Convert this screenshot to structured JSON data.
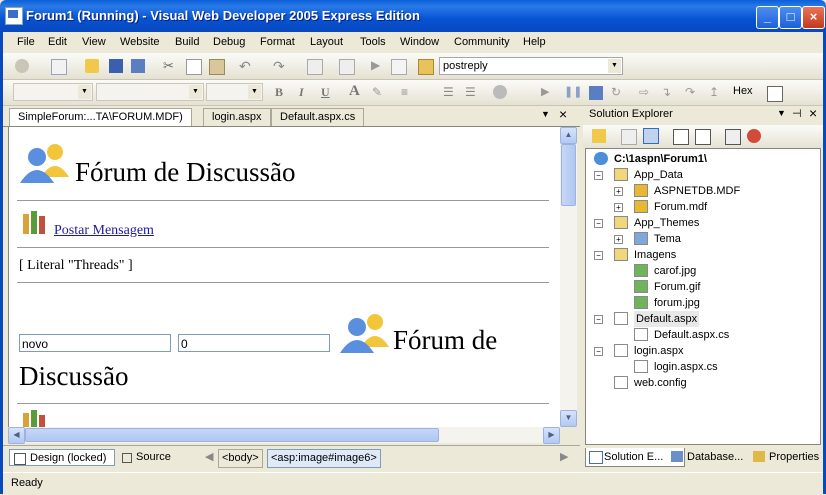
{
  "window": {
    "title": "Forum1 (Running) - Visual Web Developer 2005 Express Edition",
    "min": "_",
    "max": "□",
    "close": "×"
  },
  "menu": [
    "File",
    "Edit",
    "View",
    "Website",
    "Build",
    "Debug",
    "Format",
    "Layout",
    "Tools",
    "Window",
    "Community",
    "Help"
  ],
  "toolbar": {
    "find_combo": "postreply",
    "hex_label": "Hex",
    "bold": "B",
    "italic": "I",
    "underline": "U",
    "font_a": "A"
  },
  "doc_tabs": [
    "SimpleForum:...TA\\FORUM.MDF)",
    "login.aspx",
    "Default.aspx.cs"
  ],
  "design": {
    "heading1": "Fórum de Discussão",
    "post_link": "Postar Mensagem",
    "literal": "[ Literal \"Threads\" ]",
    "input1": "novo",
    "input2": "0",
    "heading2_line1": "Fórum de",
    "heading2_line2": "Discussão"
  },
  "view_bar": {
    "design": "Design (locked)",
    "source": "Source",
    "crumb1": "<body>",
    "crumb2": "<asp:image#image6>"
  },
  "solution_explorer": {
    "title": "Solution Explorer",
    "root": "C:\\1aspn\\Forum1\\",
    "items": [
      {
        "label": "App_Data",
        "level": 1,
        "icon": "folder-icon",
        "toggle": "−"
      },
      {
        "label": "ASPNETDB.MDF",
        "level": 2,
        "icon": "database-icon",
        "toggle": "+"
      },
      {
        "label": "Forum.mdf",
        "level": 2,
        "icon": "database-icon",
        "toggle": "+"
      },
      {
        "label": "App_Themes",
        "level": 1,
        "icon": "folder-icon",
        "toggle": "−"
      },
      {
        "label": "Tema",
        "level": 2,
        "icon": "theme-icon",
        "toggle": "+"
      },
      {
        "label": "Imagens",
        "level": 1,
        "icon": "folder-open-icon",
        "toggle": "−"
      },
      {
        "label": "carof.jpg",
        "level": 2,
        "icon": "image-file-icon",
        "toggle": ""
      },
      {
        "label": "Forum.gif",
        "level": 2,
        "icon": "image-file-icon",
        "toggle": ""
      },
      {
        "label": "forum.jpg",
        "level": 2,
        "icon": "image-file-icon",
        "toggle": ""
      },
      {
        "label": "Default.aspx",
        "level": 1,
        "icon": "aspx-file-icon",
        "toggle": "−"
      },
      {
        "label": "Default.aspx.cs",
        "level": 2,
        "icon": "cs-file-icon",
        "toggle": ""
      },
      {
        "label": "login.aspx",
        "level": 1,
        "icon": "aspx-file-icon",
        "toggle": "−"
      },
      {
        "label": "login.aspx.cs",
        "level": 2,
        "icon": "cs-file-icon",
        "toggle": ""
      },
      {
        "label": "web.config",
        "level": 1,
        "icon": "config-file-icon",
        "toggle": ""
      }
    ],
    "tabs": [
      "Solution E...",
      "Database...",
      "Properties"
    ]
  },
  "status": "Ready"
}
